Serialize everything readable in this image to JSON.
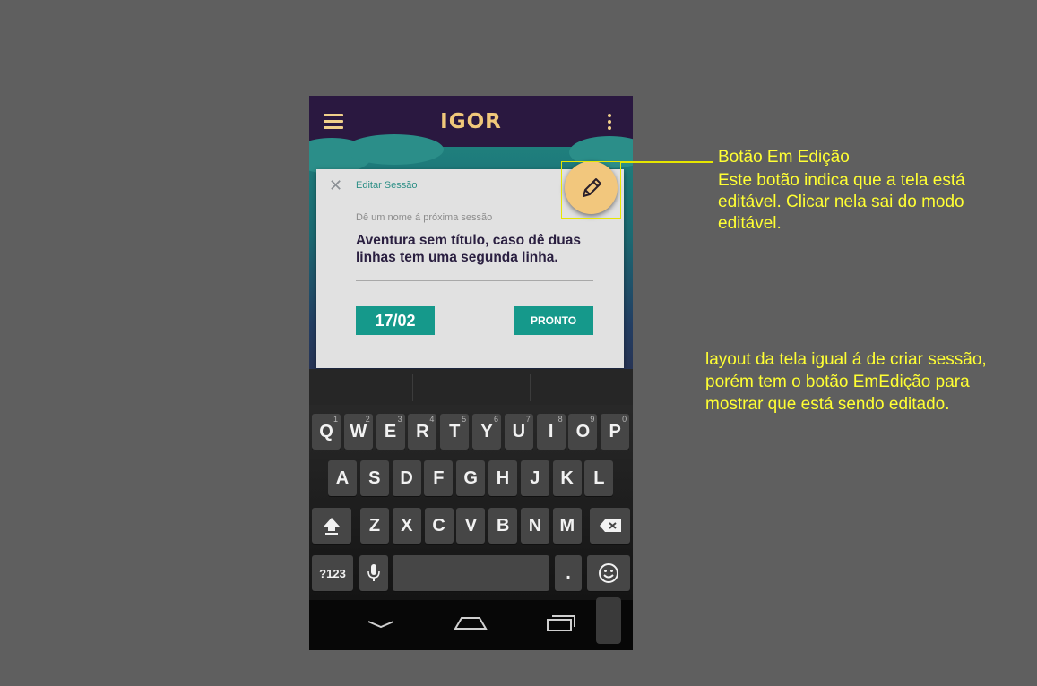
{
  "app": {
    "logo": "IGOR",
    "brand_color": "#f0c87a",
    "header_bg": "#2a1840",
    "menu_icon": "hamburger-menu-icon",
    "overflow_icon": "more-vertical-icon"
  },
  "dialog": {
    "close_symbol": "✕",
    "title": "Editar Sessão",
    "field_label": "Dê um nome á próxima sessão",
    "field_value": "Aventura sem título, caso dê duas linhas  tem uma segunda linha.",
    "date_button": "17/02",
    "done_button": "PRONTO",
    "accent_color": "#15998b"
  },
  "edit_fab": {
    "icon": "pencil-icon",
    "color": "#f2c77d"
  },
  "keyboard": {
    "row1": [
      {
        "key": "Q",
        "hint": "1"
      },
      {
        "key": "W",
        "hint": "2"
      },
      {
        "key": "E",
        "hint": "3"
      },
      {
        "key": "R",
        "hint": "4"
      },
      {
        "key": "T",
        "hint": "5"
      },
      {
        "key": "Y",
        "hint": "6"
      },
      {
        "key": "U",
        "hint": "7"
      },
      {
        "key": "I",
        "hint": "8"
      },
      {
        "key": "O",
        "hint": "9"
      },
      {
        "key": "P",
        "hint": "0"
      }
    ],
    "row2": [
      "A",
      "S",
      "D",
      "F",
      "G",
      "H",
      "J",
      "K",
      "L"
    ],
    "row3": [
      "Z",
      "X",
      "C",
      "V",
      "B",
      "N",
      "M"
    ],
    "symbols_key": "?123",
    "period_key": "."
  },
  "navbar": {
    "icons": [
      "back-icon",
      "home-icon",
      "recent-apps-icon"
    ]
  },
  "annotations": {
    "callout_title": "Botão Em Edição",
    "callout_body": "Este botão indica que a tela está editável. Clicar nela sai do modo editável.",
    "layout_note": "layout da tela igual á de criar sessão, porém tem o botão EmEdição para mostrar que está sendo editado.",
    "annotation_color": "#ffff33"
  }
}
